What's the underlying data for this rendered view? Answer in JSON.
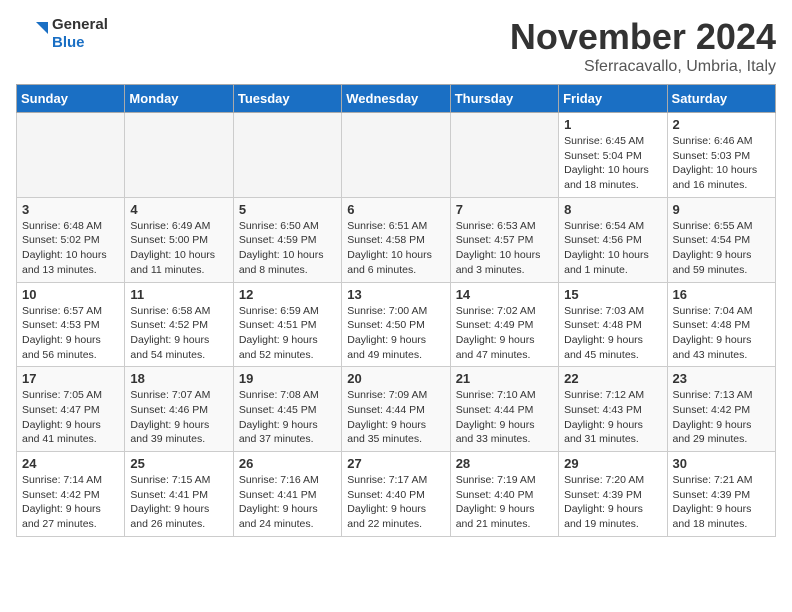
{
  "header": {
    "logo_general": "General",
    "logo_blue": "Blue",
    "month_title": "November 2024",
    "location": "Sferracavallo, Umbria, Italy"
  },
  "weekdays": [
    "Sunday",
    "Monday",
    "Tuesday",
    "Wednesday",
    "Thursday",
    "Friday",
    "Saturday"
  ],
  "weeks": [
    [
      {
        "day": "",
        "info": ""
      },
      {
        "day": "",
        "info": ""
      },
      {
        "day": "",
        "info": ""
      },
      {
        "day": "",
        "info": ""
      },
      {
        "day": "",
        "info": ""
      },
      {
        "day": "1",
        "info": "Sunrise: 6:45 AM\nSunset: 5:04 PM\nDaylight: 10 hours\nand 18 minutes."
      },
      {
        "day": "2",
        "info": "Sunrise: 6:46 AM\nSunset: 5:03 PM\nDaylight: 10 hours\nand 16 minutes."
      }
    ],
    [
      {
        "day": "3",
        "info": "Sunrise: 6:48 AM\nSunset: 5:02 PM\nDaylight: 10 hours\nand 13 minutes."
      },
      {
        "day": "4",
        "info": "Sunrise: 6:49 AM\nSunset: 5:00 PM\nDaylight: 10 hours\nand 11 minutes."
      },
      {
        "day": "5",
        "info": "Sunrise: 6:50 AM\nSunset: 4:59 PM\nDaylight: 10 hours\nand 8 minutes."
      },
      {
        "day": "6",
        "info": "Sunrise: 6:51 AM\nSunset: 4:58 PM\nDaylight: 10 hours\nand 6 minutes."
      },
      {
        "day": "7",
        "info": "Sunrise: 6:53 AM\nSunset: 4:57 PM\nDaylight: 10 hours\nand 3 minutes."
      },
      {
        "day": "8",
        "info": "Sunrise: 6:54 AM\nSunset: 4:56 PM\nDaylight: 10 hours\nand 1 minute."
      },
      {
        "day": "9",
        "info": "Sunrise: 6:55 AM\nSunset: 4:54 PM\nDaylight: 9 hours\nand 59 minutes."
      }
    ],
    [
      {
        "day": "10",
        "info": "Sunrise: 6:57 AM\nSunset: 4:53 PM\nDaylight: 9 hours\nand 56 minutes."
      },
      {
        "day": "11",
        "info": "Sunrise: 6:58 AM\nSunset: 4:52 PM\nDaylight: 9 hours\nand 54 minutes."
      },
      {
        "day": "12",
        "info": "Sunrise: 6:59 AM\nSunset: 4:51 PM\nDaylight: 9 hours\nand 52 minutes."
      },
      {
        "day": "13",
        "info": "Sunrise: 7:00 AM\nSunset: 4:50 PM\nDaylight: 9 hours\nand 49 minutes."
      },
      {
        "day": "14",
        "info": "Sunrise: 7:02 AM\nSunset: 4:49 PM\nDaylight: 9 hours\nand 47 minutes."
      },
      {
        "day": "15",
        "info": "Sunrise: 7:03 AM\nSunset: 4:48 PM\nDaylight: 9 hours\nand 45 minutes."
      },
      {
        "day": "16",
        "info": "Sunrise: 7:04 AM\nSunset: 4:48 PM\nDaylight: 9 hours\nand 43 minutes."
      }
    ],
    [
      {
        "day": "17",
        "info": "Sunrise: 7:05 AM\nSunset: 4:47 PM\nDaylight: 9 hours\nand 41 minutes."
      },
      {
        "day": "18",
        "info": "Sunrise: 7:07 AM\nSunset: 4:46 PM\nDaylight: 9 hours\nand 39 minutes."
      },
      {
        "day": "19",
        "info": "Sunrise: 7:08 AM\nSunset: 4:45 PM\nDaylight: 9 hours\nand 37 minutes."
      },
      {
        "day": "20",
        "info": "Sunrise: 7:09 AM\nSunset: 4:44 PM\nDaylight: 9 hours\nand 35 minutes."
      },
      {
        "day": "21",
        "info": "Sunrise: 7:10 AM\nSunset: 4:44 PM\nDaylight: 9 hours\nand 33 minutes."
      },
      {
        "day": "22",
        "info": "Sunrise: 7:12 AM\nSunset: 4:43 PM\nDaylight: 9 hours\nand 31 minutes."
      },
      {
        "day": "23",
        "info": "Sunrise: 7:13 AM\nSunset: 4:42 PM\nDaylight: 9 hours\nand 29 minutes."
      }
    ],
    [
      {
        "day": "24",
        "info": "Sunrise: 7:14 AM\nSunset: 4:42 PM\nDaylight: 9 hours\nand 27 minutes."
      },
      {
        "day": "25",
        "info": "Sunrise: 7:15 AM\nSunset: 4:41 PM\nDaylight: 9 hours\nand 26 minutes."
      },
      {
        "day": "26",
        "info": "Sunrise: 7:16 AM\nSunset: 4:41 PM\nDaylight: 9 hours\nand 24 minutes."
      },
      {
        "day": "27",
        "info": "Sunrise: 7:17 AM\nSunset: 4:40 PM\nDaylight: 9 hours\nand 22 minutes."
      },
      {
        "day": "28",
        "info": "Sunrise: 7:19 AM\nSunset: 4:40 PM\nDaylight: 9 hours\nand 21 minutes."
      },
      {
        "day": "29",
        "info": "Sunrise: 7:20 AM\nSunset: 4:39 PM\nDaylight: 9 hours\nand 19 minutes."
      },
      {
        "day": "30",
        "info": "Sunrise: 7:21 AM\nSunset: 4:39 PM\nDaylight: 9 hours\nand 18 minutes."
      }
    ]
  ]
}
